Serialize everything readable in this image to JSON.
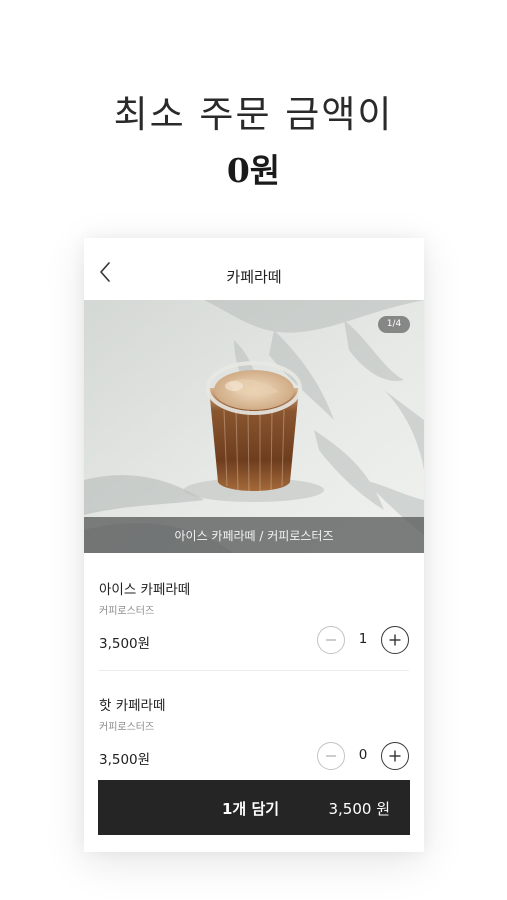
{
  "headline": {
    "line1": "최소 주문 금액이",
    "line2": "0원"
  },
  "screen": {
    "title": "카페라떼",
    "back_icon": "chevron-left-icon",
    "hero": {
      "page_indicator": "1/4",
      "caption": "아이스 카페라떼 / 커피로스터즈"
    },
    "products": [
      {
        "name": "아이스 카페라떼",
        "store": "커피로스터즈",
        "price": "3,500원",
        "quantity": "1"
      },
      {
        "name": "핫 카페라떼",
        "store": "커피로스터즈",
        "price": "3,500원",
        "quantity": "0"
      }
    ],
    "cart": {
      "label": "1개 담기",
      "total": "3,500 원"
    }
  },
  "colors": {
    "cart_button": "#252525",
    "background": "#ffffff",
    "stepper_plus_border": "#3a3a3a",
    "stepper_minus_border": "#c4c4c4"
  }
}
